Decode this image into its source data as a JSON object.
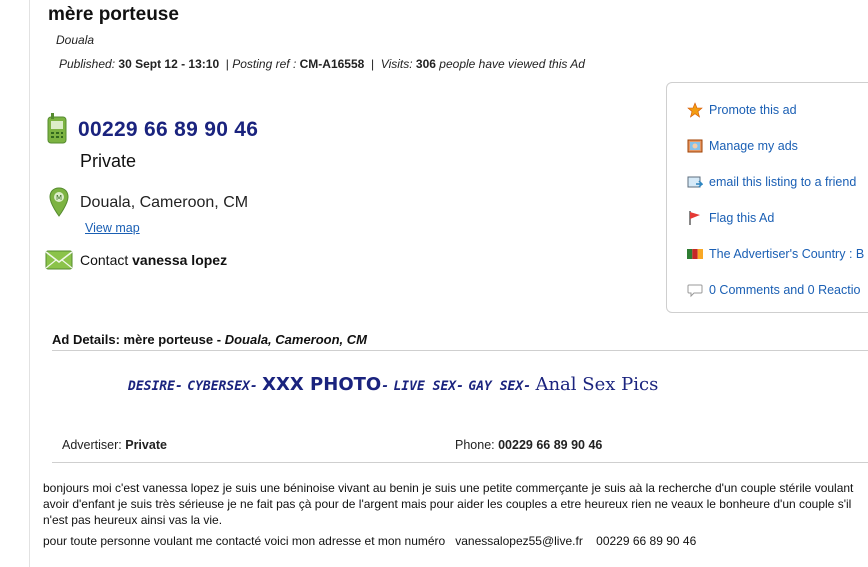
{
  "ad": {
    "title": "mère porteuse",
    "location": "Douala",
    "published_label": "Published:",
    "published_date": "30 Sept 12 - 13:10",
    "posting_ref_label": "Posting ref :",
    "posting_ref": "CM-A16558",
    "visits_label": "Visits:",
    "visits_count": "306",
    "visits_suffix": "people have viewed this Ad"
  },
  "contact": {
    "phone": "00229 66 89 90 46",
    "type": "Private",
    "city": "Douala, Cameroon, CM",
    "view_map": "View map",
    "contact_label": "Contact",
    "contact_name": "vanessa lopez"
  },
  "sidebar": {
    "promote": "Promote this ad",
    "manage": "Manage my ads",
    "email": "email this listing to a friend",
    "flag": "Flag this Ad",
    "country": "The Advertiser's Country : B",
    "comments": "0 Comments and 0 Reactio"
  },
  "details": {
    "heading_label": "Ad Details:",
    "heading_title": "mère porteuse -",
    "heading_location": "Douala, Cameroon, CM"
  },
  "promo_links": {
    "desire": "DESIRE",
    "cybersex": "CYBERSEX",
    "xxx_photo": "XXX PHOTO",
    "live_sex": "LIVE SEX",
    "gay_sex": "GAY SEX",
    "anal": "Anal Sex Pics",
    "sep": "-"
  },
  "info": {
    "advertiser_label": "Advertiser:",
    "advertiser_value": "Private",
    "phone_label": "Phone:",
    "phone_value": "00229 66 89 90 46"
  },
  "body": {
    "description": "bonjours moi c'est vanessa lopez je suis une béninoise vivant au benin je suis  une petite commerçante je suis aà la recherche d'un couple stérile  voulant avoir d'enfant je suis très sérieuse je ne fait pas çà pour de l'argent mais pour aider les couples a etre heureux rien ne veaux le bonheure d'un couple s'il n'est pas heureux ainsi vas la vie.",
    "contact_line": "pour toute personne voulant me contacté voici mon adresse et mon numéro   vanessalopez55@live.fr    00229 66 89 90 46"
  },
  "colors": {
    "link": "#1a5fb4",
    "phone": "#1a237e",
    "icon_green": "#7cb342"
  }
}
